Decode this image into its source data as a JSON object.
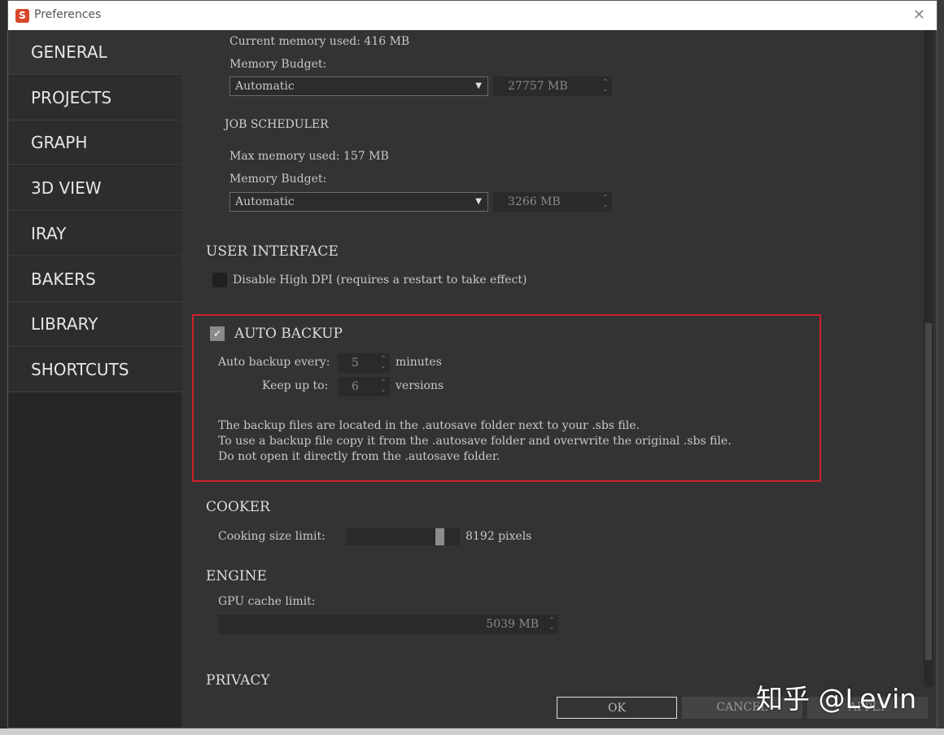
{
  "window": {
    "title": "Preferences",
    "app_icon": "substance-designer-icon",
    "close_label": "✕"
  },
  "sidebar": {
    "items": [
      {
        "label": "GENERAL",
        "active": true
      },
      {
        "label": "PROJECTS"
      },
      {
        "label": "GRAPH"
      },
      {
        "label": "3D VIEW"
      },
      {
        "label": "IRAY"
      },
      {
        "label": "BAKERS"
      },
      {
        "label": "LIBRARY"
      },
      {
        "label": "SHORTCUTS"
      }
    ]
  },
  "memory": {
    "current_used": "Current memory used: 416 MB",
    "budget_label": "Memory Budget:",
    "budget_mode": "Automatic",
    "budget_value": "27757 MB"
  },
  "job_scheduler": {
    "title": "JOB SCHEDULER",
    "max_used": "Max memory used: 157 MB",
    "budget_label": "Memory Budget:",
    "budget_mode": "Automatic",
    "budget_value": "3266 MB"
  },
  "user_interface": {
    "title": "USER INTERFACE",
    "disable_high_dpi": "Disable High DPI (requires a restart to take effect)",
    "disable_high_dpi_checked": false
  },
  "auto_backup": {
    "title": "AUTO BACKUP",
    "enabled": true,
    "every_label": "Auto backup every:",
    "every_value": "5",
    "every_unit": "minutes",
    "keep_label": "Keep up to:",
    "keep_value": "6",
    "keep_unit": "versions",
    "info_lines": [
      "The backup files are located in the .autosave folder next to your .sbs file.",
      "To use a backup file copy it from the .autosave folder and overwrite the original .sbs file.",
      "Do not open it directly from the .autosave folder."
    ]
  },
  "cooker": {
    "title": "COOKER",
    "size_limit_label": "Cooking size limit:",
    "size_limit_value": "8192 pixels",
    "slider_fraction": 0.85
  },
  "engine": {
    "title": "ENGINE",
    "gpu_cache_label": "GPU cache limit:",
    "gpu_cache_value": "5039 MB"
  },
  "privacy": {
    "title": "PRIVACY"
  },
  "buttons": {
    "ok": "OK",
    "cancel": "CANCEL",
    "apply": "APPLY"
  },
  "watermark": "知乎 @Levin",
  "colors": {
    "highlight": "#d0202a",
    "panel": "#333333",
    "sidebar": "#2d2d2d"
  }
}
